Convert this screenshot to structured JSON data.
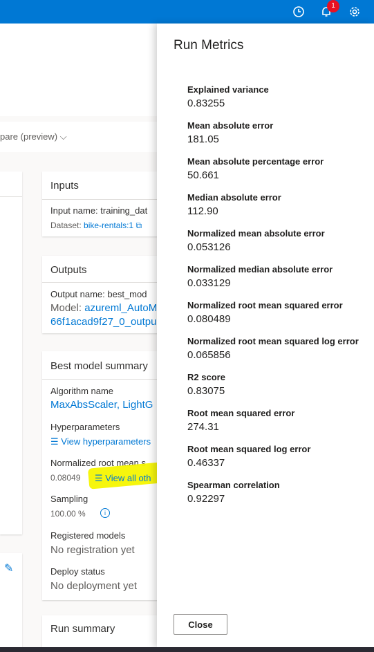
{
  "topbar": {
    "icons": [
      "clock-icon",
      "bell-icon",
      "gear-icon"
    ],
    "notification_count": "1",
    "accent": "#0078d4"
  },
  "toolbar": {
    "compare_label": "pare (preview)"
  },
  "inputs_card": {
    "title": "Inputs",
    "input_name": "Input name: training_dat",
    "dataset_label": "Dataset:",
    "dataset_link": "bike-rentals:1"
  },
  "outputs_card": {
    "title": "Outputs",
    "output_name": "Output name: best_mod",
    "model_label": "Model:",
    "model_link_line1": "azureml_AutoM",
    "model_link_line2": "66f1acad9f27_0_outpu"
  },
  "summary_card": {
    "title": "Best model summary",
    "algorithm_label": "Algorithm name",
    "algorithm_value": "MaxAbsScaler, LightG",
    "hyperparameters_label": "Hyperparameters",
    "hyperparameters_link": "View hyperparameters",
    "nrmse_label": "Normalized root mean s",
    "nrmse_value": "0.08049",
    "view_all_link": "View all oth",
    "sampling_label": "Sampling",
    "sampling_value": "100.00 %",
    "registered_label": "Registered models",
    "registered_value": "No registration yet",
    "deploy_label": "Deploy status",
    "deploy_value": "No deployment yet"
  },
  "run_summary_card": {
    "title": "Run summary"
  },
  "panel": {
    "title": "Run Metrics",
    "metrics": [
      {
        "name": "Explained variance",
        "value": "0.83255"
      },
      {
        "name": "Mean absolute error",
        "value": "181.05"
      },
      {
        "name": "Mean absolute percentage error",
        "value": "50.661"
      },
      {
        "name": "Median absolute error",
        "value": "112.90"
      },
      {
        "name": "Normalized mean absolute error",
        "value": "0.053126"
      },
      {
        "name": "Normalized median absolute error",
        "value": "0.033129"
      },
      {
        "name": "Normalized root mean squared error",
        "value": "0.080489"
      },
      {
        "name": "Normalized root mean squared log error",
        "value": "0.065856"
      },
      {
        "name": "R2 score",
        "value": "0.83075"
      },
      {
        "name": "Root mean squared error",
        "value": "274.31"
      },
      {
        "name": "Root mean squared log error",
        "value": "0.46337"
      },
      {
        "name": "Spearman correlation",
        "value": "0.92297"
      }
    ],
    "close_label": "Close"
  }
}
